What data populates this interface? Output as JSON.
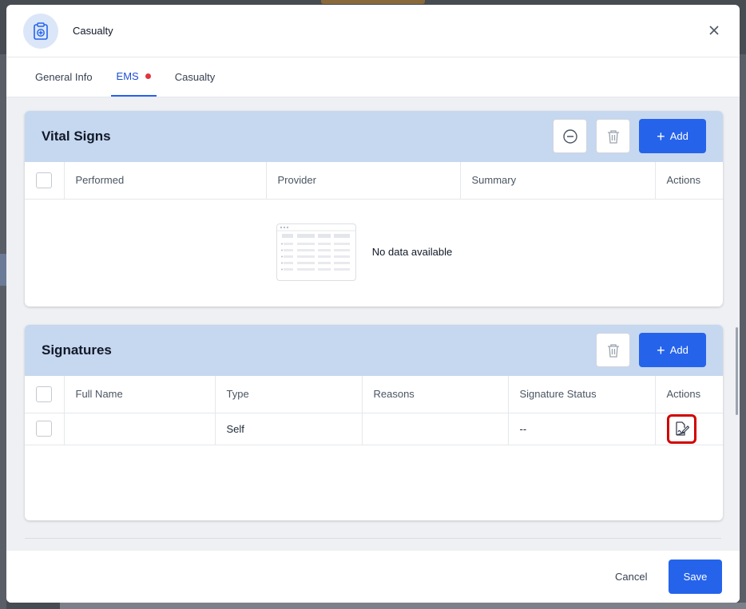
{
  "modal": {
    "title": "Casualty",
    "header_icon": "medical-clipboard-icon"
  },
  "tabs": [
    {
      "label": "General Info",
      "active": false
    },
    {
      "label": "EMS",
      "active": true,
      "indicator_color": "#e0343f"
    },
    {
      "label": "Casualty",
      "active": false
    }
  ],
  "vital_signs": {
    "title": "Vital Signs",
    "add_label": "Add",
    "columns": [
      "Performed",
      "Provider",
      "Summary",
      "Actions"
    ],
    "empty_text": "No data available"
  },
  "signatures": {
    "title": "Signatures",
    "add_label": "Add",
    "columns": [
      "Full Name",
      "Type",
      "Reasons",
      "Signature Status",
      "Actions"
    ],
    "rows": [
      {
        "full_name": "",
        "type": "Self",
        "reasons": "",
        "status": "--",
        "action_icon": "sign-document-icon"
      }
    ]
  },
  "footer": {
    "cancel_label": "Cancel",
    "save_label": "Save"
  },
  "colors": {
    "primary": "#2563eb",
    "card_header": "#c6d7f0",
    "highlight": "#d10000"
  }
}
